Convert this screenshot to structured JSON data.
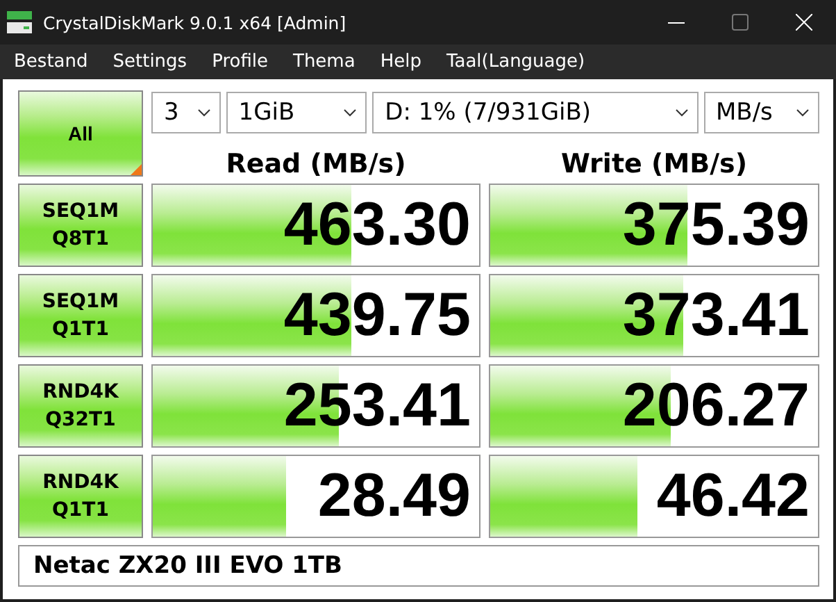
{
  "window": {
    "title": "CrystalDiskMark 9.0.1 x64 [Admin]"
  },
  "menu": [
    "Bestand",
    "Settings",
    "Profile",
    "Thema",
    "Help",
    "Taal(Language)"
  ],
  "all_button": {
    "label": "All"
  },
  "selectors": [
    {
      "value": "3",
      "kind": "count"
    },
    {
      "value": "1GiB",
      "kind": "size"
    },
    {
      "value": "D: 1% (7/931GiB)",
      "kind": "drive"
    },
    {
      "value": "MB/s",
      "kind": "unit"
    }
  ],
  "columns": [
    "Read (MB/s)",
    "Write (MB/s)"
  ],
  "tests": [
    {
      "line1": "SEQ1M",
      "line2": "Q8T1",
      "read": {
        "value": "463.30",
        "level": 0.61
      },
      "write": {
        "value": "375.39",
        "level": 0.6
      }
    },
    {
      "line1": "SEQ1M",
      "line2": "Q1T1",
      "read": {
        "value": "439.75",
        "level": 0.61
      },
      "write": {
        "value": "373.41",
        "level": 0.59
      }
    },
    {
      "line1": "RND4K",
      "line2": "Q32T1",
      "read": {
        "value": "253.41",
        "level": 0.57
      },
      "write": {
        "value": "206.27",
        "level": 0.55
      }
    },
    {
      "line1": "RND4K",
      "line2": "Q1T1",
      "read": {
        "value": "28.49",
        "level": 0.41
      },
      "write": {
        "value": "46.42",
        "level": 0.45
      }
    }
  ],
  "comment": "Netac ZX20 III EVO 1TB"
}
